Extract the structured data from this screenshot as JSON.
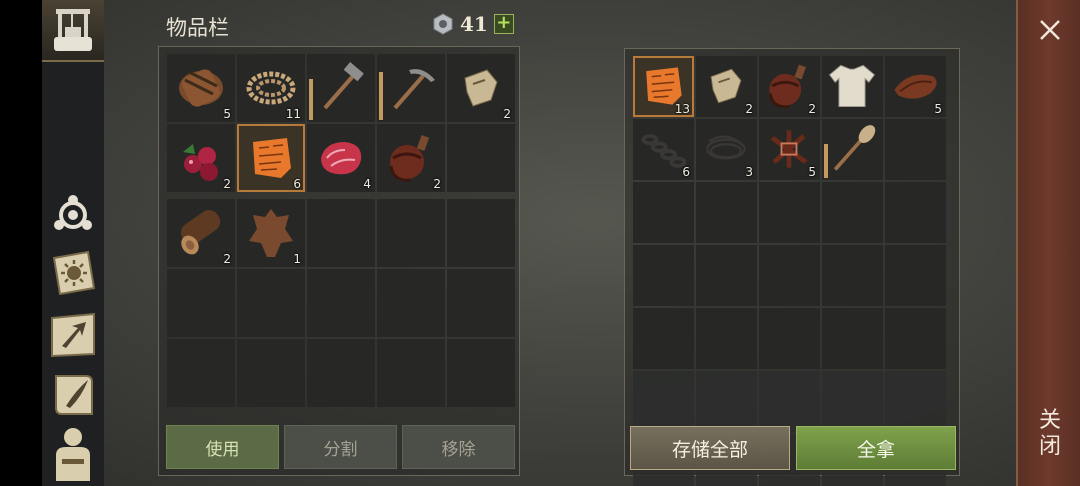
{
  "inventory": {
    "title": "物品栏",
    "currency": {
      "icon": "hex-nut-icon",
      "amount": "41",
      "add": "+"
    },
    "main_slots": [
      {
        "item": "barrel",
        "count": "5"
      },
      {
        "item": "rope",
        "count": "11"
      },
      {
        "item": "hammer",
        "count": "",
        "durability": 0.6
      },
      {
        "item": "pickaxe",
        "count": "",
        "durability": 0.7
      },
      {
        "item": "paper-scrap",
        "count": "2"
      },
      {
        "item": "berries",
        "count": "2"
      },
      {
        "item": "clay-tablet",
        "count": "6",
        "selected": true
      },
      {
        "item": "raw-meat",
        "count": "4"
      },
      {
        "item": "flask",
        "count": "2"
      },
      {
        "item": "",
        "count": ""
      }
    ],
    "bag_slots": [
      {
        "item": "log",
        "count": "2"
      },
      {
        "item": "leather-hide",
        "count": "1"
      },
      {
        "item": "",
        "count": ""
      },
      {
        "item": "",
        "count": ""
      },
      {
        "item": "",
        "count": ""
      },
      {
        "item": "",
        "count": ""
      },
      {
        "item": "",
        "count": ""
      },
      {
        "item": "",
        "count": ""
      },
      {
        "item": "",
        "count": ""
      },
      {
        "item": "",
        "count": ""
      },
      {
        "item": "",
        "count": ""
      },
      {
        "item": "",
        "count": ""
      },
      {
        "item": "",
        "count": ""
      },
      {
        "item": "",
        "count": ""
      },
      {
        "item": "",
        "count": ""
      }
    ],
    "buttons": {
      "use": "使用",
      "split": "分割",
      "remove": "移除"
    }
  },
  "storage": {
    "slots": [
      {
        "item": "clay-tablet",
        "count": "13",
        "selected": true
      },
      {
        "item": "paper-scrap",
        "count": "2"
      },
      {
        "item": "flask",
        "count": "2"
      },
      {
        "item": "shirt",
        "count": ""
      },
      {
        "item": "leather-strip",
        "count": "5"
      },
      {
        "item": "chain",
        "count": "6"
      },
      {
        "item": "wire",
        "count": "3"
      },
      {
        "item": "bandage-bundle",
        "count": "5"
      },
      {
        "item": "shovel",
        "count": "",
        "durability": 0.55
      },
      {
        "item": "",
        "count": ""
      }
    ],
    "empty_rows": 5,
    "buttons": {
      "store_all": "存储全部",
      "take_all": "全拿"
    }
  },
  "sidebar": {
    "icons": [
      "water-well-icon",
      "crafting-tripod-icon",
      "sun-book-icon",
      "map-arrow-icon",
      "scroll-quill-icon",
      "character-icon"
    ]
  },
  "close": {
    "label": "关闭",
    "icon": "close-icon"
  }
}
